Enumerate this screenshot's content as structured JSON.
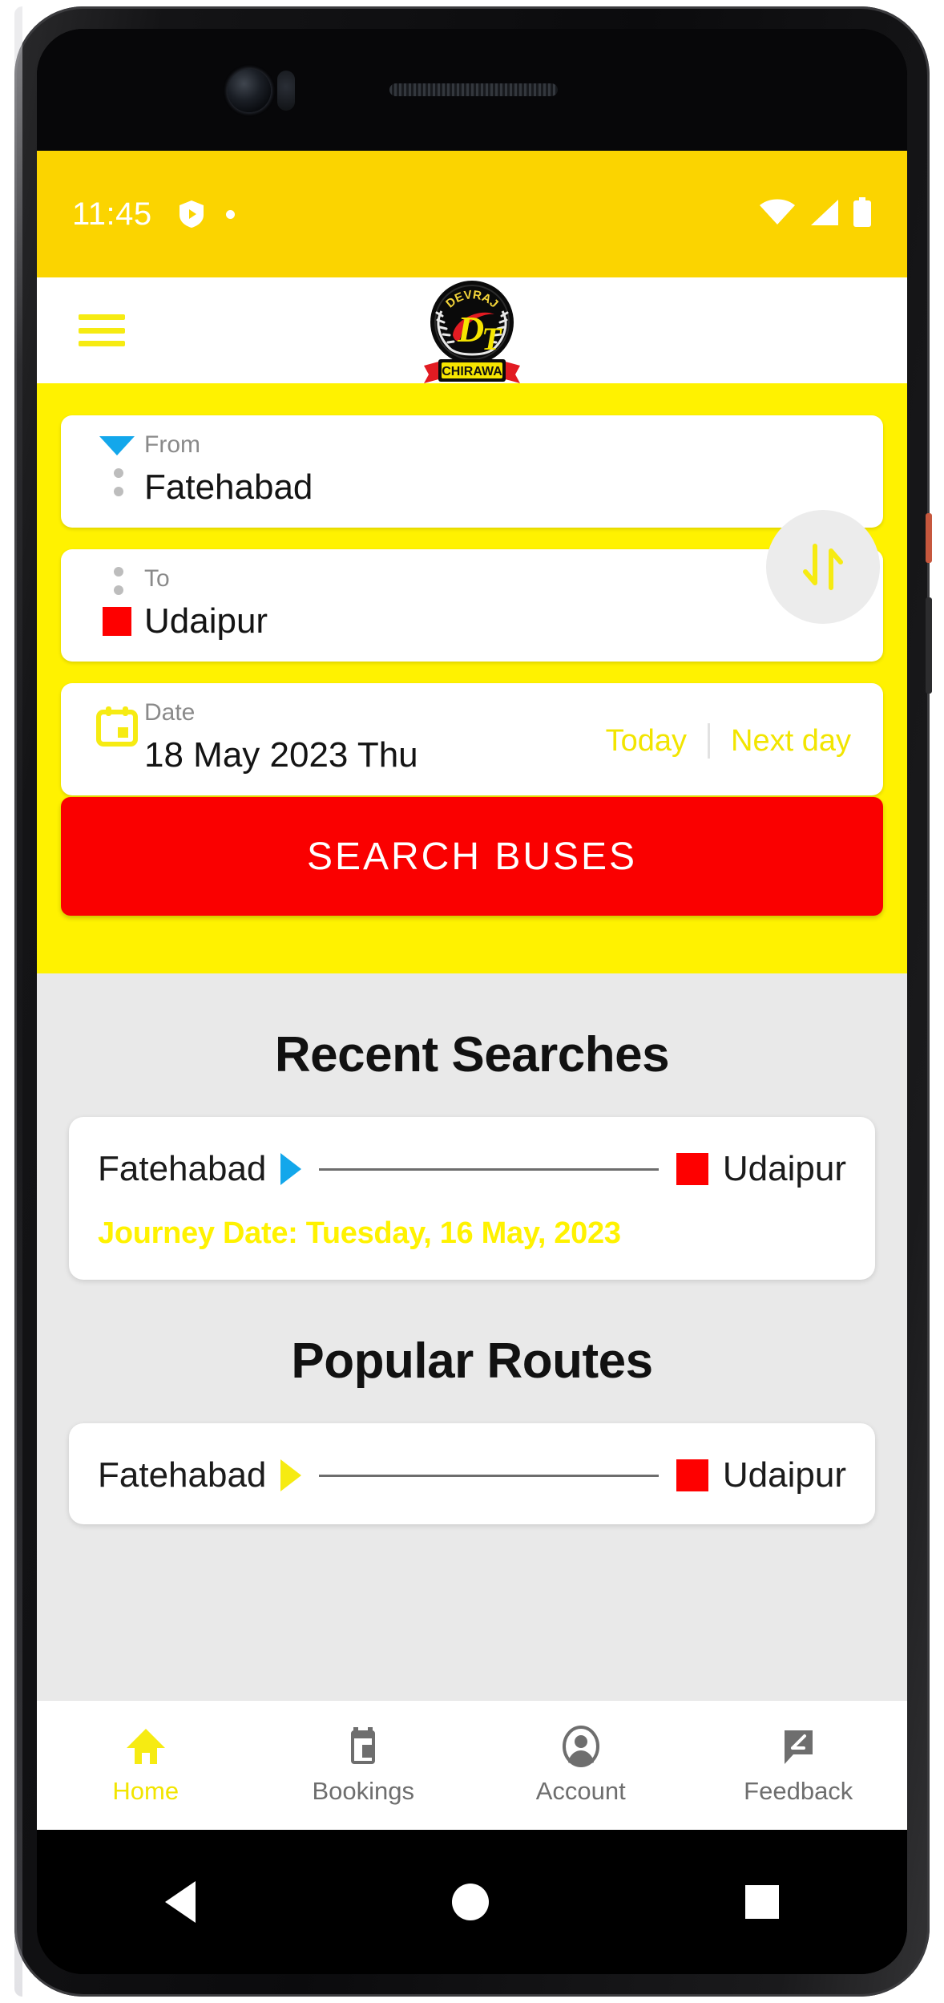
{
  "status_bar": {
    "time": "11:45",
    "icons": [
      "shield-play-icon",
      "dot-indicator",
      "wifi-icon",
      "signal-icon",
      "battery-icon"
    ],
    "background": "#FBD400"
  },
  "header": {
    "menu_icon": "hamburger-menu-icon",
    "logo": {
      "top_text": "DEVRAJ",
      "letter_primary": "D",
      "letter_secondary": "T",
      "banner_text": "CHIRAWA"
    }
  },
  "search_form": {
    "from": {
      "label": "From",
      "value": "Fatehabad",
      "marker": "blue-triangle-down"
    },
    "to": {
      "label": "To",
      "value": "Udaipur",
      "marker": "red-square"
    },
    "date": {
      "label": "Date",
      "value": "18 May 2023 Thu",
      "icon": "calendar-icon"
    },
    "quick_dates": {
      "today": "Today",
      "next_day": "Next day"
    },
    "swap_icon": "swap-vertical-arrows-icon",
    "submit_label": "SEARCH BUSES",
    "accent_yellow": "#FFF200",
    "submit_color": "#FA0000"
  },
  "recent_searches": {
    "title": "Recent Searches",
    "items": [
      {
        "origin": "Fatehabad",
        "destination": "Udaipur",
        "arrow": "blue-triangle-right",
        "journey_date": "Journey Date: Tuesday, 16 May, 2023"
      }
    ]
  },
  "popular_routes": {
    "title": "Popular Routes",
    "items": [
      {
        "origin": "Fatehabad",
        "destination": "Udaipur",
        "arrow": "yellow-triangle-right"
      }
    ]
  },
  "bottom_nav": {
    "items": [
      {
        "label": "Home",
        "icon": "home-icon",
        "active": true
      },
      {
        "label": "Bookings",
        "icon": "ticket-icon",
        "active": false
      },
      {
        "label": "Account",
        "icon": "person-circle-icon",
        "active": false
      },
      {
        "label": "Feedback",
        "icon": "feedback-pencil-icon",
        "active": false
      }
    ],
    "active_color": "#F2E500",
    "inactive_color": "#6e6e6e"
  },
  "android_nav": {
    "back": "back-triangle-icon",
    "home": "home-circle-icon",
    "recents": "recents-square-icon"
  }
}
